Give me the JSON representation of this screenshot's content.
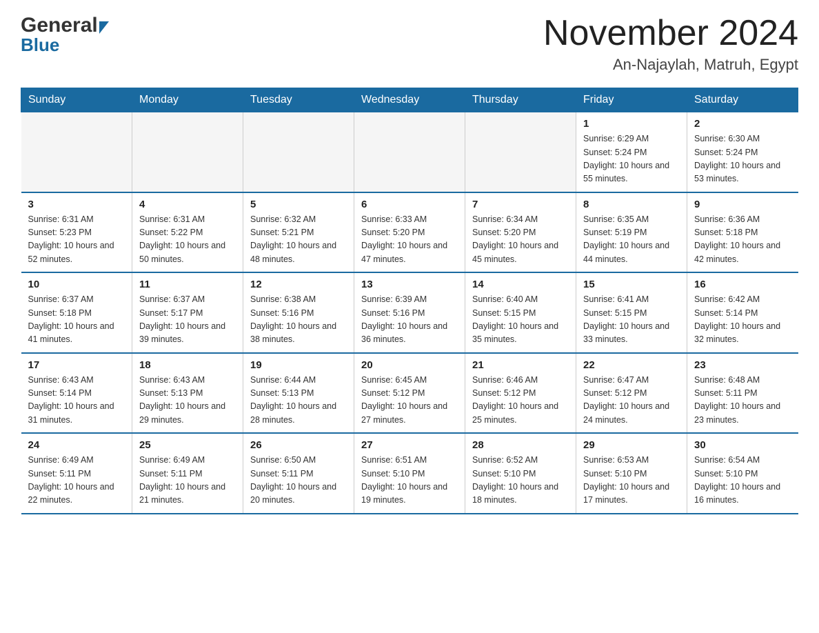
{
  "header": {
    "logo_general": "General",
    "logo_blue": "Blue",
    "title": "November 2024",
    "subtitle": "An-Najaylah, Matruh, Egypt"
  },
  "days_of_week": [
    "Sunday",
    "Monday",
    "Tuesday",
    "Wednesday",
    "Thursday",
    "Friday",
    "Saturday"
  ],
  "weeks": [
    [
      {
        "day": "",
        "info": ""
      },
      {
        "day": "",
        "info": ""
      },
      {
        "day": "",
        "info": ""
      },
      {
        "day": "",
        "info": ""
      },
      {
        "day": "",
        "info": ""
      },
      {
        "day": "1",
        "info": "Sunrise: 6:29 AM\nSunset: 5:24 PM\nDaylight: 10 hours and 55 minutes."
      },
      {
        "day": "2",
        "info": "Sunrise: 6:30 AM\nSunset: 5:24 PM\nDaylight: 10 hours and 53 minutes."
      }
    ],
    [
      {
        "day": "3",
        "info": "Sunrise: 6:31 AM\nSunset: 5:23 PM\nDaylight: 10 hours and 52 minutes."
      },
      {
        "day": "4",
        "info": "Sunrise: 6:31 AM\nSunset: 5:22 PM\nDaylight: 10 hours and 50 minutes."
      },
      {
        "day": "5",
        "info": "Sunrise: 6:32 AM\nSunset: 5:21 PM\nDaylight: 10 hours and 48 minutes."
      },
      {
        "day": "6",
        "info": "Sunrise: 6:33 AM\nSunset: 5:20 PM\nDaylight: 10 hours and 47 minutes."
      },
      {
        "day": "7",
        "info": "Sunrise: 6:34 AM\nSunset: 5:20 PM\nDaylight: 10 hours and 45 minutes."
      },
      {
        "day": "8",
        "info": "Sunrise: 6:35 AM\nSunset: 5:19 PM\nDaylight: 10 hours and 44 minutes."
      },
      {
        "day": "9",
        "info": "Sunrise: 6:36 AM\nSunset: 5:18 PM\nDaylight: 10 hours and 42 minutes."
      }
    ],
    [
      {
        "day": "10",
        "info": "Sunrise: 6:37 AM\nSunset: 5:18 PM\nDaylight: 10 hours and 41 minutes."
      },
      {
        "day": "11",
        "info": "Sunrise: 6:37 AM\nSunset: 5:17 PM\nDaylight: 10 hours and 39 minutes."
      },
      {
        "day": "12",
        "info": "Sunrise: 6:38 AM\nSunset: 5:16 PM\nDaylight: 10 hours and 38 minutes."
      },
      {
        "day": "13",
        "info": "Sunrise: 6:39 AM\nSunset: 5:16 PM\nDaylight: 10 hours and 36 minutes."
      },
      {
        "day": "14",
        "info": "Sunrise: 6:40 AM\nSunset: 5:15 PM\nDaylight: 10 hours and 35 minutes."
      },
      {
        "day": "15",
        "info": "Sunrise: 6:41 AM\nSunset: 5:15 PM\nDaylight: 10 hours and 33 minutes."
      },
      {
        "day": "16",
        "info": "Sunrise: 6:42 AM\nSunset: 5:14 PM\nDaylight: 10 hours and 32 minutes."
      }
    ],
    [
      {
        "day": "17",
        "info": "Sunrise: 6:43 AM\nSunset: 5:14 PM\nDaylight: 10 hours and 31 minutes."
      },
      {
        "day": "18",
        "info": "Sunrise: 6:43 AM\nSunset: 5:13 PM\nDaylight: 10 hours and 29 minutes."
      },
      {
        "day": "19",
        "info": "Sunrise: 6:44 AM\nSunset: 5:13 PM\nDaylight: 10 hours and 28 minutes."
      },
      {
        "day": "20",
        "info": "Sunrise: 6:45 AM\nSunset: 5:12 PM\nDaylight: 10 hours and 27 minutes."
      },
      {
        "day": "21",
        "info": "Sunrise: 6:46 AM\nSunset: 5:12 PM\nDaylight: 10 hours and 25 minutes."
      },
      {
        "day": "22",
        "info": "Sunrise: 6:47 AM\nSunset: 5:12 PM\nDaylight: 10 hours and 24 minutes."
      },
      {
        "day": "23",
        "info": "Sunrise: 6:48 AM\nSunset: 5:11 PM\nDaylight: 10 hours and 23 minutes."
      }
    ],
    [
      {
        "day": "24",
        "info": "Sunrise: 6:49 AM\nSunset: 5:11 PM\nDaylight: 10 hours and 22 minutes."
      },
      {
        "day": "25",
        "info": "Sunrise: 6:49 AM\nSunset: 5:11 PM\nDaylight: 10 hours and 21 minutes."
      },
      {
        "day": "26",
        "info": "Sunrise: 6:50 AM\nSunset: 5:11 PM\nDaylight: 10 hours and 20 minutes."
      },
      {
        "day": "27",
        "info": "Sunrise: 6:51 AM\nSunset: 5:10 PM\nDaylight: 10 hours and 19 minutes."
      },
      {
        "day": "28",
        "info": "Sunrise: 6:52 AM\nSunset: 5:10 PM\nDaylight: 10 hours and 18 minutes."
      },
      {
        "day": "29",
        "info": "Sunrise: 6:53 AM\nSunset: 5:10 PM\nDaylight: 10 hours and 17 minutes."
      },
      {
        "day": "30",
        "info": "Sunrise: 6:54 AM\nSunset: 5:10 PM\nDaylight: 10 hours and 16 minutes."
      }
    ]
  ]
}
